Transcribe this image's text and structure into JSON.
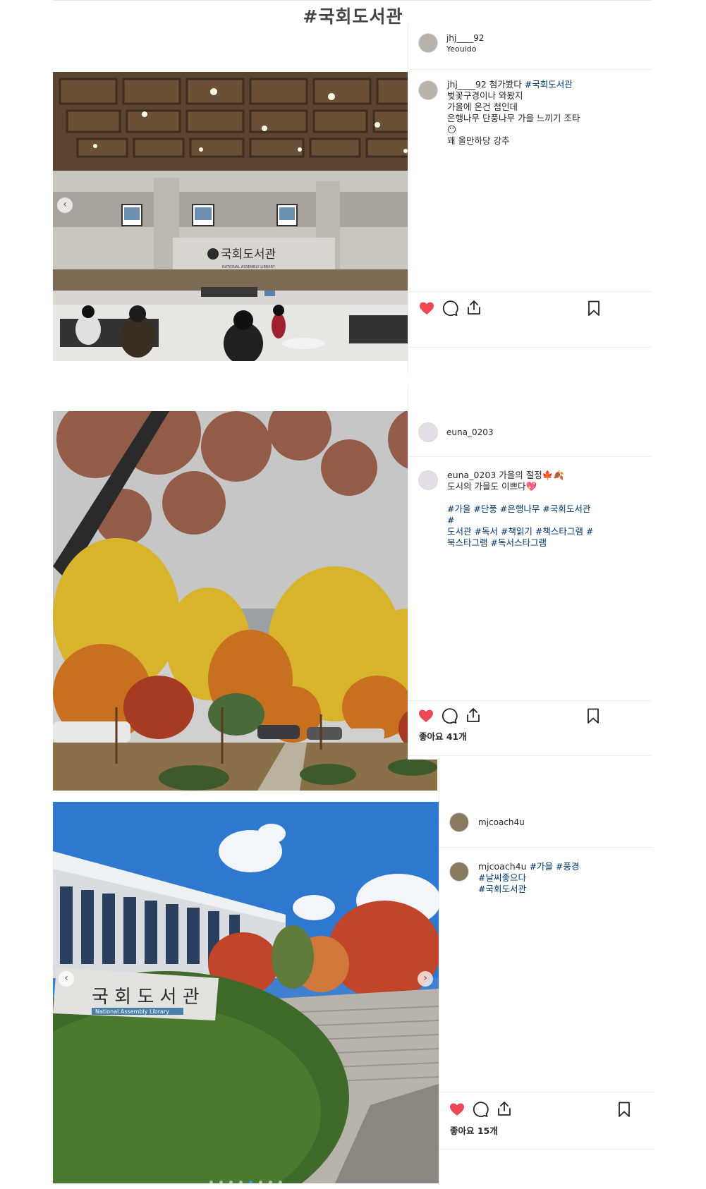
{
  "page": {
    "title": "#국회도서관"
  },
  "colors": {
    "like_red": "#ed4956",
    "hashtag_blue": "#003569",
    "border": "#efefef"
  },
  "posts": [
    {
      "username": "jhj____92",
      "location": "Yeouido",
      "image_alt": "국회도서관 lobby interior",
      "sign_text": "국회도서관",
      "sign_subtext": "NATIONAL ASSEMBLY LIBRARY",
      "caption": {
        "username": "jhj____92",
        "lines": [
          "첨가봤다 ",
          "벚꽃구경이나 와봤지",
          "가을에 온건 첨인데",
          "은행나무 단풍나무 가을 느끼기 조타",
          "😶",
          "꽤 올만하당 강추"
        ],
        "hashtags_line1": "#국회도서관"
      },
      "liked": true,
      "likes_text": ""
    },
    {
      "username": "euna_0203",
      "location": "",
      "image_alt": "autumn trees",
      "caption": {
        "username": "euna_0203",
        "line1": "가을의 절정🍁🍂",
        "line2": "도시의 가을도 이쁘다💖",
        "hashtags": [
          "#가을 #단풍 #은행나무 #국회도서관 #",
          "도서관 #독서 #책읽기 #책스타그램 #",
          "북스타그램 #독서스타그램"
        ]
      },
      "liked": true,
      "likes_text": "좋아요 41개"
    },
    {
      "username": "mjcoach4u",
      "location": "",
      "image_alt": "National Assembly Library exterior sign",
      "sign_text": "국 회 도 서 관",
      "sign_subtext": "National Assembly Library",
      "caption": {
        "username": "mjcoach4u",
        "tags_first": "#가을 #풍경",
        "line2": "#날씨좋으다",
        "line3": "#국회도서관"
      },
      "liked": true,
      "likes_text": "좋아요 15개",
      "nav": {
        "prev": "‹",
        "next": "›"
      }
    }
  ],
  "icons": [
    "heart-icon",
    "comment-icon",
    "share-icon",
    "bookmark-icon"
  ]
}
